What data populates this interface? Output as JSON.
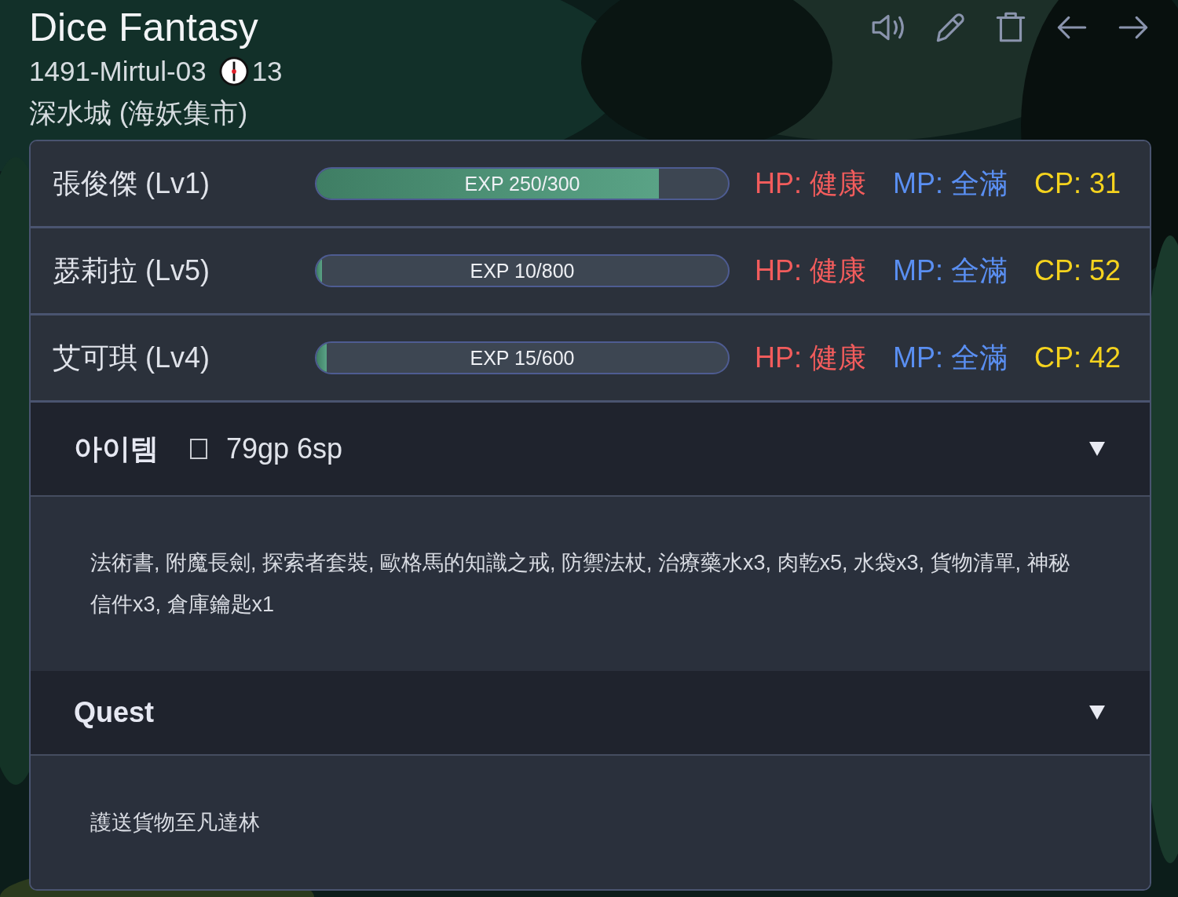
{
  "header": {
    "title": "Dice Fantasy",
    "date": "1491-Mirtul-03",
    "hour": "13",
    "location": "深水城 (海妖集市)"
  },
  "characters": [
    {
      "name": "張俊傑 (Lv1)",
      "exp": "EXP 250/300",
      "level": 0.833,
      "hp": "HP: 健康",
      "mp": "MP: 全滿",
      "cp": "CP: 31"
    },
    {
      "name": "瑟莉拉 (Lv5)",
      "exp": "EXP 10/800",
      "level": 0.0125,
      "hp": "HP: 健康",
      "mp": "MP: 全滿",
      "cp": "CP: 52"
    },
    {
      "name": "艾可琪 (Lv4)",
      "exp": "EXP 15/600",
      "level": 0.025,
      "hp": "HP: 健康",
      "mp": "MP: 全滿",
      "cp": "CP: 42"
    }
  ],
  "sections": [
    {
      "kind": "items",
      "title": "아이템",
      "money": "79gp 6sp",
      "expanded": true,
      "content": "法術書, 附魔長劍, 探索者套裝, 歐格馬的知識之戒, 防禦法杖, 治療藥水x3, 肉乾x5, 水袋x3, 貨物清單, 神秘信件x3, 倉庫鑰匙x1"
    },
    {
      "kind": "quest",
      "title": "Quest",
      "expanded": true,
      "content": "護送貨物至凡達林"
    }
  ]
}
